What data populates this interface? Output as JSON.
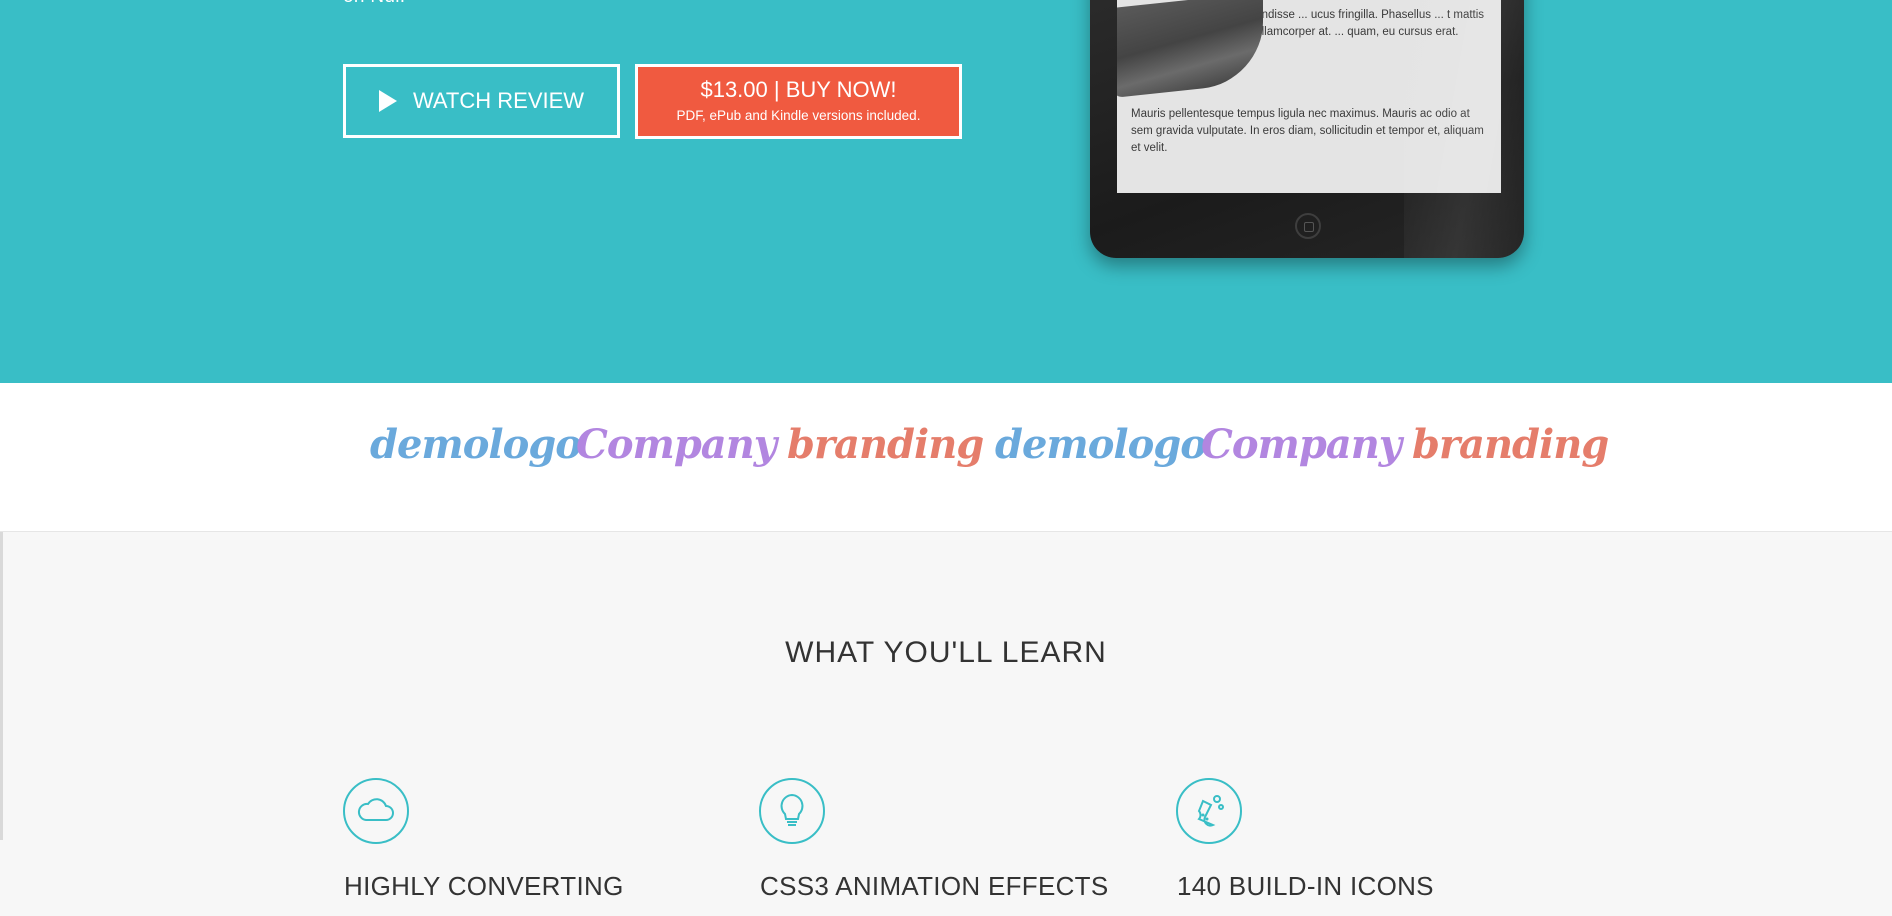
{
  "hero": {
    "tail_text": "on Nul.",
    "watch_label": "WATCH REVIEW",
    "buy_label": "$13.00 | BUY NOW!",
    "buy_sub": "PDF, ePub and Kindle versions included.",
    "accent": "#39bec6",
    "cta_color": "#f05a40"
  },
  "tablet": {
    "text1": "Suspendisse ... ucus fringilla. Phasellus ... t mattis urna ullamcorper at. ... quam, eu cursus erat.",
    "text2": "Mauris pellentesque tempus ligula nec maximus. Mauris ac odio at sem gravida vulputate. In eros diam, sollicitudin et tempor et, aliquam et velit."
  },
  "logos": [
    {
      "text": "demologo",
      "color": "#6aa9dc"
    },
    {
      "text": "Company",
      "color": "#b286e0"
    },
    {
      "text": "branding",
      "color": "#e57d6b"
    },
    {
      "text": "demologo",
      "color": "#6aa9dc"
    },
    {
      "text": "Company",
      "color": "#b286e0"
    },
    {
      "text": "branding",
      "color": "#e57d6b"
    }
  ],
  "learn": {
    "title": "WHAT YOU'LL LEARN",
    "features": [
      {
        "icon": "cloud-icon",
        "title": "HIGHLY CONVERTING"
      },
      {
        "icon": "lightbulb-icon",
        "title": "CSS3 ANIMATION EFFECTS"
      },
      {
        "icon": "flask-icon",
        "title": "140 BUILD-IN ICONS"
      }
    ]
  }
}
